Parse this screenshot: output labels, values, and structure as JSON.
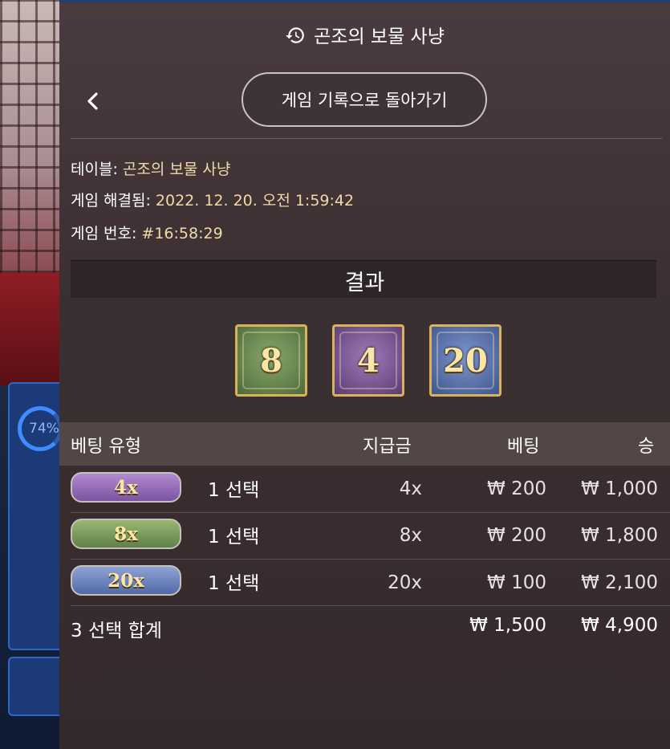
{
  "side": {
    "progress_text": "74%",
    "progress_value": 0.74
  },
  "header": {
    "title": "곤조의 보물 사냥",
    "icon": "history-icon"
  },
  "nav": {
    "back_icon": "chevron-left-icon",
    "history_button": "게임 기록으로 돌아가기"
  },
  "info": {
    "table_label": "테이블:",
    "table_value": "곤조의 보물 사냥",
    "resolved_label": "게임 해결됨:",
    "resolved_value": "2022. 12. 20. 오전 1:59:42",
    "number_label": "게임 번호:",
    "number_value": "#16:58:29"
  },
  "result": {
    "title": "결과",
    "tiles": [
      {
        "value": "8",
        "color": "#5d7d46"
      },
      {
        "value": "4",
        "color": "#6b4a86"
      },
      {
        "value": "20",
        "color": "#4a62a0"
      }
    ]
  },
  "table": {
    "headers": {
      "bet_type": "베팅 유형",
      "payout": "지급금",
      "bet": "베팅",
      "win": "승"
    },
    "rows": [
      {
        "badge": "4x",
        "selection": "1 선택",
        "payout": "4x",
        "bet": "₩ 200",
        "win": "₩ 1,000"
      },
      {
        "badge": "8x",
        "selection": "1 선택",
        "payout": "8x",
        "bet": "₩ 200",
        "win": "₩ 1,800"
      },
      {
        "badge": "20x",
        "selection": "1 선택",
        "payout": "20x",
        "bet": "₩ 100",
        "win": "₩ 2,100"
      }
    ],
    "total": {
      "label": "3 선택 합계",
      "bet": "₩ 1,500",
      "win": "₩ 4,900"
    }
  }
}
